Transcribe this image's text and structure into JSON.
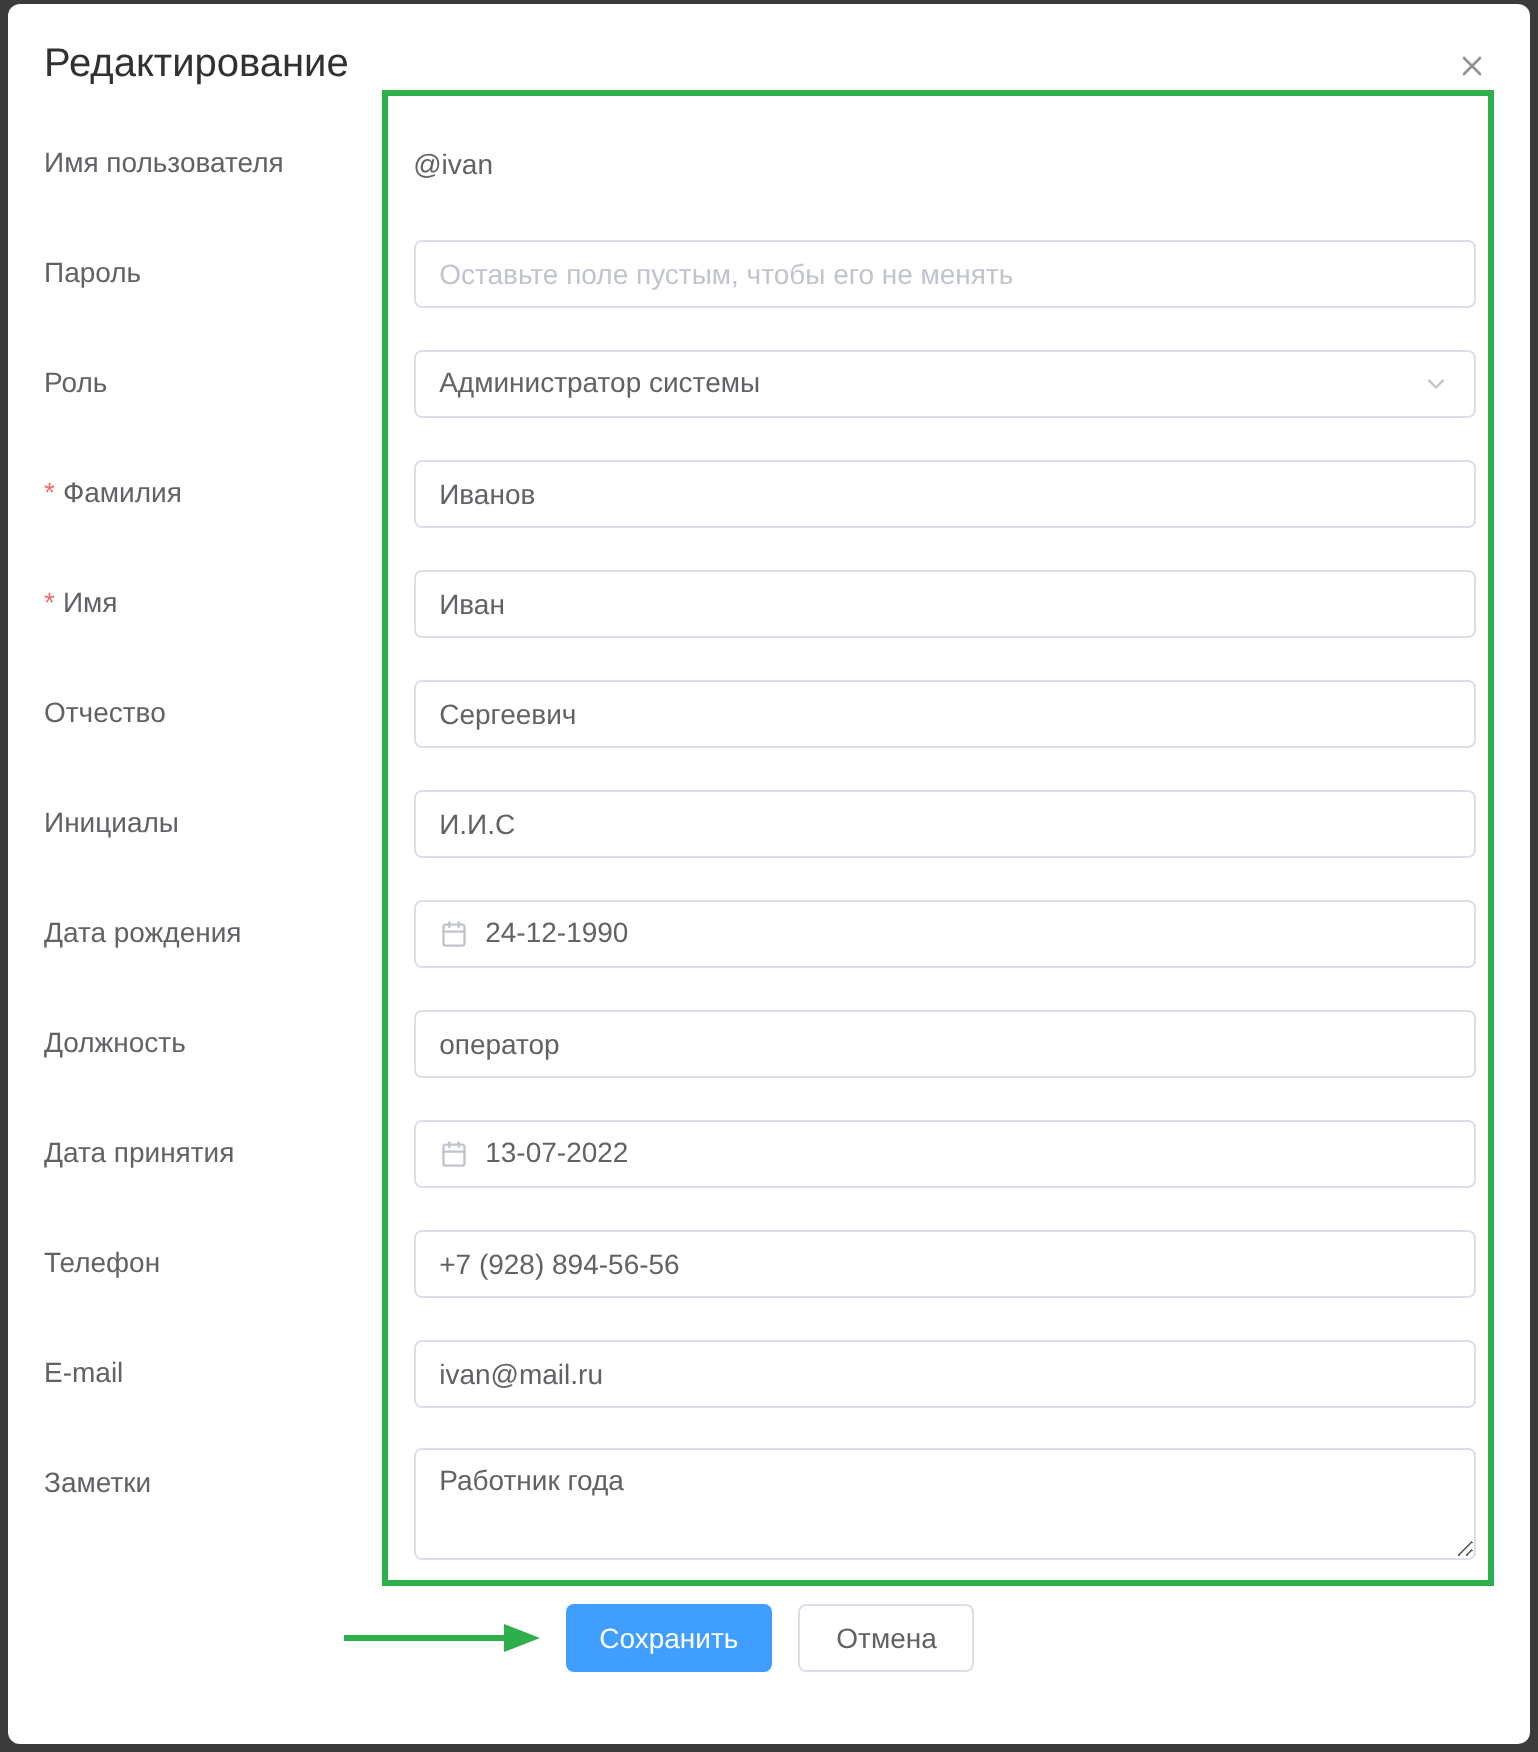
{
  "dialog": {
    "title": "Редактирование"
  },
  "required_mark": "*",
  "fields": [
    {
      "label": "Имя пользователя",
      "required": false,
      "kind": "static",
      "value": "@ivan"
    },
    {
      "label": "Пароль",
      "required": false,
      "kind": "input",
      "placeholder": "Оставьте поле пустым, чтобы его не менять"
    },
    {
      "label": "Роль",
      "required": false,
      "kind": "select",
      "value": "Администратор системы"
    },
    {
      "label": "Фамилия",
      "required": true,
      "kind": "input",
      "value": "Иванов"
    },
    {
      "label": "Имя",
      "required": true,
      "kind": "input",
      "value": "Иван"
    },
    {
      "label": "Отчество",
      "required": false,
      "kind": "input",
      "value": "Сергеевич"
    },
    {
      "label": "Инициалы",
      "required": false,
      "kind": "input",
      "value": "И.И.С"
    },
    {
      "label": "Дата рождения",
      "required": false,
      "kind": "date",
      "value": "24-12-1990"
    },
    {
      "label": "Должность",
      "required": false,
      "kind": "input",
      "value": "оператор"
    },
    {
      "label": "Дата принятия",
      "required": false,
      "kind": "date",
      "value": "13-07-2022"
    },
    {
      "label": "Телефон",
      "required": false,
      "kind": "input",
      "value": "+7 (928) 894-56-56"
    },
    {
      "label": "E-mail",
      "required": false,
      "kind": "input",
      "value": "ivan@mail.ru"
    },
    {
      "label": "Заметки",
      "required": false,
      "kind": "textarea",
      "value": "Работник года"
    }
  ],
  "buttons": [
    {
      "label": "Сохранить",
      "kind": "primary"
    },
    {
      "label": "Отмена",
      "kind": "default"
    }
  ]
}
